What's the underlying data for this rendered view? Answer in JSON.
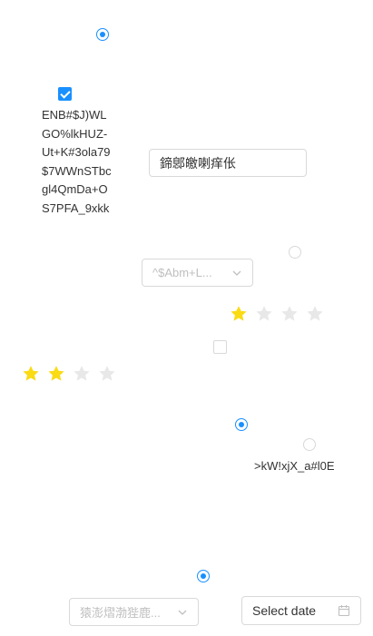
{
  "radios": {
    "radio_1": {
      "checked": true
    },
    "radio_2": {
      "checked": false
    },
    "radio_3": {
      "checked": true
    },
    "radio_4": {
      "checked": false,
      "label": ">kW!xjX_a#l0E"
    },
    "radio_5": {
      "checked": true
    }
  },
  "checkboxes": {
    "checkbox_1": {
      "checked": true
    },
    "checkbox_2": {
      "checked": false
    }
  },
  "multiline_text": "ENB#$J)WLGO%lkHUZ-Ut+K#3ola79$7WWnSTbcgl4QmDa+OS7PFA_9xkk",
  "text_input": {
    "value": "鍗鄎皦喇痒伥"
  },
  "select_1": {
    "placeholder": "^$Abm+L..."
  },
  "select_2": {
    "placeholder": "猿澎熠渤狴鹿..."
  },
  "rating_1": {
    "value": 1,
    "max": 4
  },
  "rating_2": {
    "value": 2,
    "max": 4
  },
  "date_picker": {
    "placeholder": "Select date",
    "icon": "calendar-icon"
  },
  "colors": {
    "accent": "#1890ff",
    "star_on": "#fadb14",
    "star_off": "#e8e8e8",
    "border": "#d9d9d9"
  }
}
